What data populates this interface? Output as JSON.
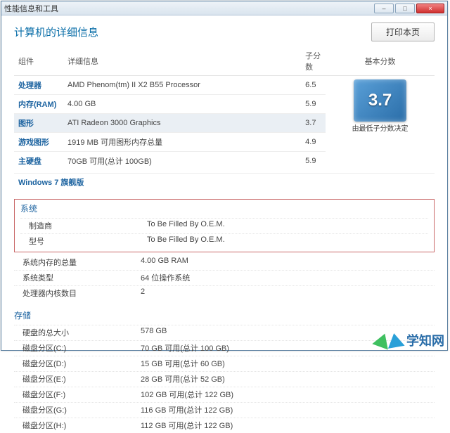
{
  "window": {
    "title": "性能信息和工具"
  },
  "controls": {
    "min": "–",
    "max": "□",
    "close": "×"
  },
  "page": {
    "title": "计算机的详细信息",
    "print_btn": "打印本页"
  },
  "wei": {
    "headers": {
      "component": "组件",
      "detail": "详细信息",
      "sub": "子分数",
      "base": "基本分数"
    },
    "rows": [
      {
        "comp": "处理器",
        "detail": "AMD Phenom(tm) II X2 B55 Processor",
        "sub": "6.5",
        "hl": false
      },
      {
        "comp": "内存(RAM)",
        "detail": "4.00 GB",
        "sub": "5.9",
        "hl": false
      },
      {
        "comp": "图形",
        "detail": "ATI Radeon 3000 Graphics",
        "sub": "3.7",
        "hl": true
      },
      {
        "comp": "游戏图形",
        "detail": "1919 MB 可用图形内存总量",
        "sub": "4.9",
        "hl": false
      },
      {
        "comp": "主硬盘",
        "detail": "70GB 可用(总计 100GB)",
        "sub": "5.9",
        "hl": false
      }
    ],
    "base_score": "3.7",
    "base_caption": "由最低子分数决定",
    "os": "Windows 7 旗舰版"
  },
  "system": {
    "title": "系统",
    "rows": [
      {
        "k": "制造商",
        "v": "To Be Filled By O.E.M."
      },
      {
        "k": "型号",
        "v": "To Be Filled By O.E.M."
      }
    ],
    "extra": [
      {
        "k": "系统内存的总量",
        "v": "4.00 GB RAM"
      },
      {
        "k": "系统类型",
        "v": "64 位操作系统"
      },
      {
        "k": "处理器内核数目",
        "v": "2"
      }
    ]
  },
  "storage": {
    "title": "存储",
    "rows": [
      {
        "k": "硬盘的总大小",
        "v": "578 GB"
      },
      {
        "k": "磁盘分区(C:)",
        "v": "70 GB 可用(总计 100 GB)"
      },
      {
        "k": "磁盘分区(D:)",
        "v": "15 GB 可用(总计 60 GB)"
      },
      {
        "k": "磁盘分区(E:)",
        "v": "28 GB 可用(总计 52 GB)"
      },
      {
        "k": "磁盘分区(F:)",
        "v": "102 GB 可用(总计 122 GB)"
      },
      {
        "k": "磁盘分区(G:)",
        "v": "116 GB 可用(总计 122 GB)"
      },
      {
        "k": "磁盘分区(H:)",
        "v": "112 GB 可用(总计 122 GB)"
      }
    ]
  },
  "brand": "学知网"
}
